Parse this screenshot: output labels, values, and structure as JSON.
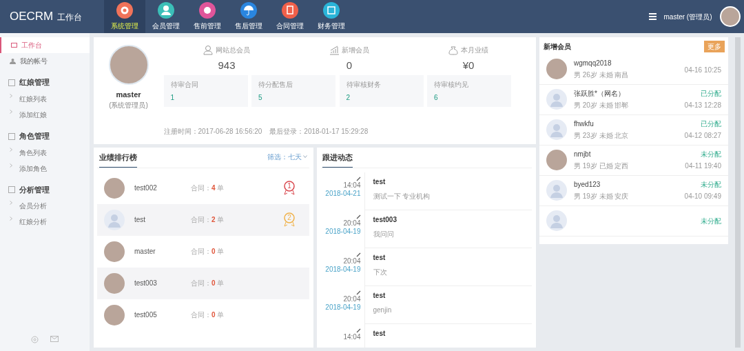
{
  "brand": {
    "name": "OECRM",
    "sub": "工作台"
  },
  "modules": [
    {
      "label": "系统管理",
      "selected": true,
      "color": "#f0735a"
    },
    {
      "label": "会员管理",
      "selected": false,
      "color": "#3bbfb8"
    },
    {
      "label": "售前管理",
      "selected": false,
      "color": "#e0559a"
    },
    {
      "label": "售后管理",
      "selected": false,
      "color": "#2a86e0"
    },
    {
      "label": "合同管理",
      "selected": false,
      "color": "#f0604a"
    },
    {
      "label": "财务管理",
      "selected": false,
      "color": "#2ab4d8"
    }
  ],
  "user": {
    "name": "master (管理员)"
  },
  "sidebar": {
    "items": [
      {
        "label": "工作台",
        "selected": true
      },
      {
        "label": "我的帐号",
        "selected": false
      }
    ],
    "groups": [
      {
        "label": "红娘管理",
        "children": [
          {
            "label": "红娘列表"
          },
          {
            "label": "添加红娘"
          }
        ]
      },
      {
        "label": "角色管理",
        "children": [
          {
            "label": "角色列表"
          },
          {
            "label": "添加角色"
          }
        ]
      },
      {
        "label": "分析管理",
        "children": [
          {
            "label": "会员分析"
          },
          {
            "label": "红娘分析"
          }
        ]
      }
    ]
  },
  "profile": {
    "name": "master",
    "role": "(系统管理员)",
    "registered": "注册时间：2017-06-28 16:56:20",
    "last_login": "最后登录：2018-01-17 15:29:28"
  },
  "stats": [
    {
      "kind": "members",
      "label": "网站总会员",
      "value": "943"
    },
    {
      "kind": "growth",
      "label": "新增会员",
      "value": "0"
    },
    {
      "kind": "money",
      "label": "本月业绩",
      "value": "¥0"
    }
  ],
  "pending": [
    {
      "label": "待审合同",
      "value": "1"
    },
    {
      "label": "待分配售后",
      "value": "5"
    },
    {
      "label": "待审核财务",
      "value": "2"
    },
    {
      "label": "待审核约见",
      "value": "6"
    }
  ],
  "ranking": {
    "title": "业绩排行榜",
    "filter": "筛选：七天",
    "rows": [
      {
        "name": "test002",
        "label": "合同：",
        "count": "4",
        "unit": "单",
        "medal": "1",
        "kind": "photo"
      },
      {
        "name": "test",
        "label": "合同：",
        "count": "2",
        "unit": "单",
        "medal": "2",
        "kind": "default"
      },
      {
        "name": "master",
        "label": "合同：",
        "count": "0",
        "unit": "单",
        "kind": "photo"
      },
      {
        "name": "test003",
        "label": "合同：",
        "count": "0",
        "unit": "单",
        "kind": "photo"
      },
      {
        "name": "test005",
        "label": "合同：",
        "count": "0",
        "unit": "单",
        "kind": "photo"
      }
    ]
  },
  "followups": {
    "title": "跟进动态",
    "items": [
      {
        "time": "14:04",
        "date": "2018-04-21",
        "name": "test",
        "content": "测试一下 专业机构"
      },
      {
        "time": "20:04",
        "date": "2018-04-19",
        "name": "test003",
        "content": "我问问"
      },
      {
        "time": "20:04",
        "date": "2018-04-19",
        "name": "test",
        "content": "下次"
      },
      {
        "time": "20:04",
        "date": "2018-04-19",
        "name": "test",
        "content": "genjin"
      },
      {
        "time": "14:04",
        "name": "test"
      }
    ]
  },
  "new_members": {
    "title": "新增会员",
    "more": "更多",
    "items": [
      {
        "name": "wgmqq2018",
        "info": "男 26岁 未婚 南昌",
        "time": "04-16 10:25",
        "kind": "photo"
      },
      {
        "name": "张跃胜*（网名）",
        "info": "男 20岁 未婚 邯郸",
        "status": "已分配",
        "time": "04-13 12:28",
        "kind": "default"
      },
      {
        "name": "fhwkfu",
        "info": "男 23岁 未婚 北京",
        "status": "已分配",
        "time": "04-12 08:27",
        "kind": "default"
      },
      {
        "name": "nmjbt",
        "info": "男 19岁 已婚 定西",
        "status": "未分配",
        "time": "04-11 19:40",
        "kind": "photo"
      },
      {
        "name": "byed123",
        "info": "男 19岁 未婚 安庆",
        "status": "未分配",
        "time": "04-10 09:49",
        "kind": "default"
      },
      {
        "status": "未分配",
        "kind": "default"
      }
    ]
  }
}
